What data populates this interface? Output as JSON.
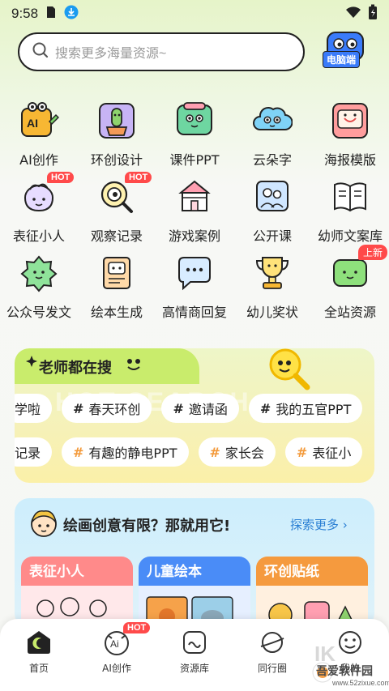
{
  "status_bar": {
    "time": "9:58"
  },
  "search": {
    "placeholder": "搜索更多海量资源~",
    "desktop_label": "电脑端"
  },
  "grid": {
    "rows": [
      [
        {
          "label": "AI创作",
          "icon": "ai-create-icon"
        },
        {
          "label": "环创设计",
          "icon": "cactus-icon"
        },
        {
          "label": "课件PPT",
          "icon": "ppt-icon"
        },
        {
          "label": "云朵字",
          "icon": "cloud-icon"
        },
        {
          "label": "海报模版",
          "icon": "poster-icon"
        }
      ],
      [
        {
          "label": "表征小人",
          "icon": "character-icon",
          "badge": "HOT"
        },
        {
          "label": "观察记录",
          "icon": "magnifier-icon",
          "badge": "HOT"
        },
        {
          "label": "游戏案例",
          "icon": "castle-icon"
        },
        {
          "label": "公开课",
          "icon": "class-icon"
        },
        {
          "label": "幼师文案库",
          "icon": "book-icon"
        }
      ],
      [
        {
          "label": "公众号发文",
          "icon": "flower-icon"
        },
        {
          "label": "绘本生成",
          "icon": "picture-book-icon"
        },
        {
          "label": "高情商回复",
          "icon": "chat-icon"
        },
        {
          "label": "幼儿奖状",
          "icon": "trophy-icon"
        },
        {
          "label": "全站资源",
          "icon": "resources-icon",
          "badge": "上新"
        }
      ]
    ]
  },
  "teacher_search": {
    "title": "老师都在搜",
    "decor_text": "HOT SEARCH",
    "row1": [
      "学啦",
      "春天环创",
      "邀请函",
      "我的五官PPT"
    ],
    "row2": [
      "记录",
      "有趣的静电PPT",
      "家长会",
      "表征小"
    ]
  },
  "drawing": {
    "title": "绘画创意有限？那就用它!",
    "more": "探索更多",
    "cards": [
      "表征小人",
      "儿童绘本",
      "环创贴纸"
    ]
  },
  "nav": {
    "items": [
      {
        "label": "首页",
        "icon": "home-icon"
      },
      {
        "label": "AI创作",
        "icon": "ai-icon",
        "badge": "HOT"
      },
      {
        "label": "资源库",
        "icon": "folder-icon"
      },
      {
        "label": "同行圈",
        "icon": "planet-icon"
      },
      {
        "label": "我的",
        "icon": "smile-icon"
      }
    ]
  },
  "watermark": {
    "title": "吾爱软件园",
    "sub": "www.52zixue.com"
  },
  "colors": {
    "accent_green": "#c9ec6c",
    "hot_red": "#ff4a4a",
    "link_blue": "#2a7fd4"
  }
}
